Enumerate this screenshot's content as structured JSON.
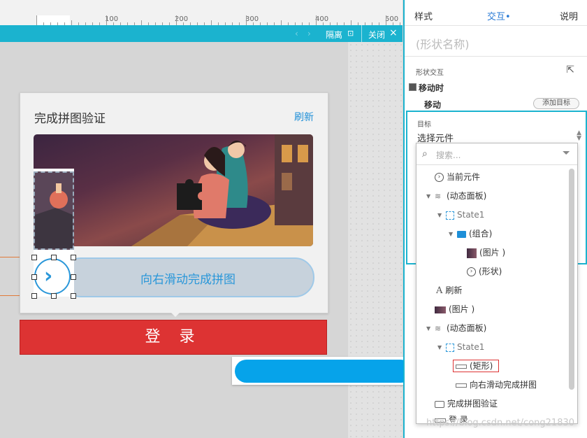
{
  "ruler": {
    "labels": [
      "0",
      "100",
      "200",
      "300",
      "400",
      "500"
    ]
  },
  "dynamic_panel_bar": {
    "hide_label": "隔离",
    "close_label": "关闭",
    "close_icon": "×"
  },
  "card": {
    "title": "完成拼图验证",
    "refresh": "刷新",
    "slider_text": "向右滑动完成拼图",
    "handle_glyph": "›"
  },
  "login_button": "登 录",
  "panel": {
    "tabs": [
      "样式",
      "交互",
      "说明"
    ],
    "active_tab_dot": "•",
    "shape_name_placeholder": "(形状名称)",
    "section_label": "形状交互",
    "event": "移动时",
    "action": "移动",
    "add_target": "添加目标",
    "target_label": "目标",
    "target_select": "选择元件"
  },
  "dropdown": {
    "search_placeholder": "搜索...",
    "items": [
      {
        "label": "当前元件",
        "icon": "circle-arrow-icon"
      },
      {
        "label": "(动态面板)",
        "icon": "layers-icon"
      },
      {
        "label": "State1",
        "icon": "state-icon"
      },
      {
        "label": "(组合)",
        "icon": "folder-icon"
      },
      {
        "label": "(图片 )",
        "icon": "image-icon"
      },
      {
        "label": "(形状)",
        "icon": "circle-arrow-icon"
      },
      {
        "label": "刷新",
        "icon": "text-icon"
      },
      {
        "label": "(图片 )",
        "icon": "image-icon"
      },
      {
        "label": "(动态面板)",
        "icon": "layers-icon"
      },
      {
        "label": "State1",
        "icon": "state-icon"
      },
      {
        "label": "(矩形)",
        "icon": "rectangle-icon"
      },
      {
        "label": "向右滑动完成拼图",
        "icon": "rectangle-icon"
      },
      {
        "label": "完成拼图验证",
        "icon": "speech-icon"
      },
      {
        "label": "登 录",
        "icon": "rectangle-icon"
      }
    ]
  },
  "watermark": "https://blog.csdn.net/cong21830"
}
